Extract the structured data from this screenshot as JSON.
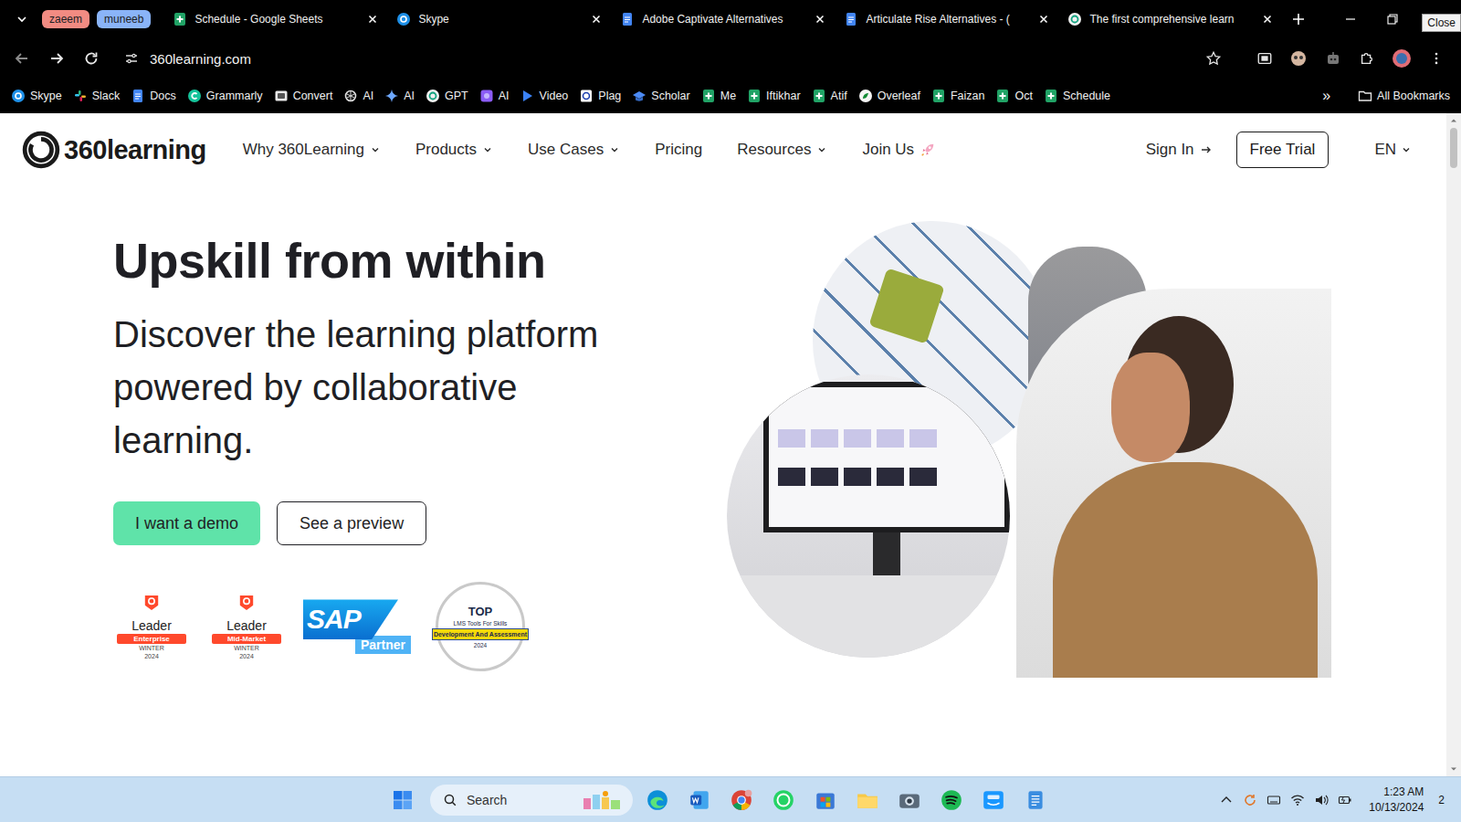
{
  "browser": {
    "tab_groups": [
      {
        "label": "zaeem",
        "color": "#f28b82"
      },
      {
        "label": "muneeb",
        "color": "#8ab4f8"
      }
    ],
    "tabs": [
      {
        "label": "Schedule - Google Sheets",
        "kind": "sheets"
      },
      {
        "label": "Skype",
        "kind": "skype"
      },
      {
        "label": "Adobe Captivate Alternatives",
        "kind": "docs"
      },
      {
        "label": "Articulate Rise Alternatives - (",
        "kind": "docs"
      },
      {
        "label": "The first comprehensive learn",
        "kind": "gpt"
      }
    ],
    "tooltip": "Close",
    "address": "360learning.com",
    "bookmarks": [
      {
        "label": "Skype",
        "kind": "skype"
      },
      {
        "label": "Slack",
        "kind": "slack"
      },
      {
        "label": "Docs",
        "kind": "docs"
      },
      {
        "label": "Grammarly",
        "kind": "grammarly"
      },
      {
        "label": "Convert",
        "kind": "convert"
      },
      {
        "label": "AI",
        "kind": "openai"
      },
      {
        "label": "AI",
        "kind": "gemini"
      },
      {
        "label": "GPT",
        "kind": "gpt"
      },
      {
        "label": "AI",
        "kind": "purple"
      },
      {
        "label": "Video",
        "kind": "video"
      },
      {
        "label": "Plag",
        "kind": "plag"
      },
      {
        "label": "Scholar",
        "kind": "scholar"
      },
      {
        "label": "Me",
        "kind": "sheets"
      },
      {
        "label": "Iftikhar",
        "kind": "sheets"
      },
      {
        "label": "Atif",
        "kind": "sheets"
      },
      {
        "label": "Overleaf",
        "kind": "overleaf"
      },
      {
        "label": "Faizan",
        "kind": "sheets"
      },
      {
        "label": "Oct",
        "kind": "sheets"
      },
      {
        "label": "Schedule",
        "kind": "sheets"
      }
    ],
    "bookmarks_more": "»",
    "all_bookmarks": "All Bookmarks"
  },
  "page": {
    "logo": "360learning",
    "nav": [
      {
        "label": "Why 360Learning",
        "kind": "menu"
      },
      {
        "label": "Products",
        "kind": "menu"
      },
      {
        "label": "Use Cases",
        "kind": "menu"
      },
      {
        "label": "Pricing",
        "kind": "link"
      },
      {
        "label": "Resources",
        "kind": "menu"
      },
      {
        "label": "Join Us",
        "kind": "rocket"
      }
    ],
    "sign_in": "Sign In",
    "free_trial": "Free Trial",
    "language": "EN",
    "title": "Upskill from within",
    "subtitle": "Discover the learning platform powered by collaborative learning.",
    "buttons": [
      {
        "label": "I want a demo",
        "kind": "primary"
      },
      {
        "label": "See a preview",
        "kind": "secondary"
      }
    ],
    "badges": [
      {
        "kind": "g2",
        "title": "Leader",
        "segment": "Enterprise",
        "season": "WINTER",
        "year": "2024"
      },
      {
        "kind": "g2",
        "title": "Leader",
        "segment": "Mid-Market",
        "season": "WINTER",
        "year": "2024"
      },
      {
        "kind": "sap",
        "title": "SAP",
        "segment": "Partner"
      },
      {
        "kind": "top",
        "title": "TOP",
        "segment": "LMS Tools For Skills",
        "ribbon": "Development And Assessment",
        "year": "2024"
      }
    ]
  },
  "taskbar": {
    "search": "Search",
    "apps": [
      {
        "kind": "edge"
      },
      {
        "kind": "word"
      },
      {
        "kind": "chrome"
      },
      {
        "kind": "whatsapp"
      },
      {
        "kind": "store"
      },
      {
        "kind": "explorer"
      },
      {
        "kind": "camera"
      },
      {
        "kind": "spotify"
      },
      {
        "kind": "prime"
      },
      {
        "kind": "notepad"
      }
    ],
    "time": "1:23 AM",
    "date": "10/13/2024",
    "notifications": "2"
  }
}
